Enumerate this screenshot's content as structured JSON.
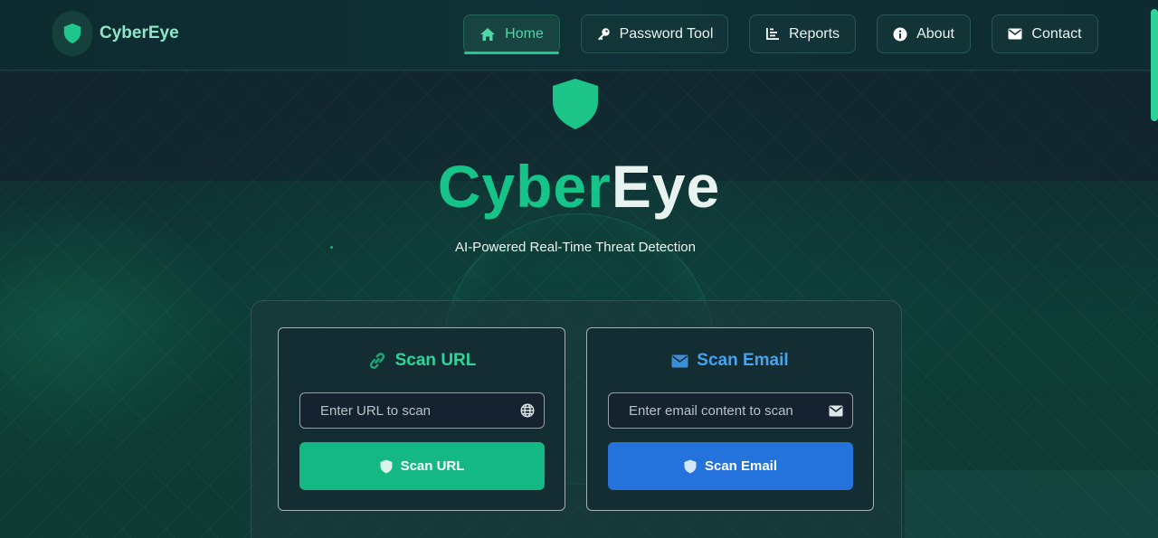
{
  "brand": {
    "name": "CyberEye"
  },
  "nav": {
    "items": [
      {
        "label": "Home",
        "icon": "home-icon",
        "active": true
      },
      {
        "label": "Password Tool",
        "icon": "key-icon",
        "active": false
      },
      {
        "label": "Reports",
        "icon": "chart-icon",
        "active": false
      },
      {
        "label": "About",
        "icon": "info-icon",
        "active": false
      },
      {
        "label": "Contact",
        "icon": "envelope-icon",
        "active": false
      }
    ]
  },
  "hero": {
    "title_part1": "Cyber",
    "title_part2": "Eye",
    "subtitle": "AI-Powered Real-Time Threat Detection"
  },
  "scan_url": {
    "title": "Scan URL",
    "placeholder": "Enter URL to scan",
    "button_label": "Scan URL"
  },
  "scan_email": {
    "title": "Scan Email",
    "placeholder": "Enter email content to scan",
    "button_label": "Scan Email"
  },
  "colors": {
    "accent_green": "#16c48a",
    "accent_blue": "#3b9ae8",
    "url_button": "#14b883",
    "email_button": "#2473dc"
  }
}
